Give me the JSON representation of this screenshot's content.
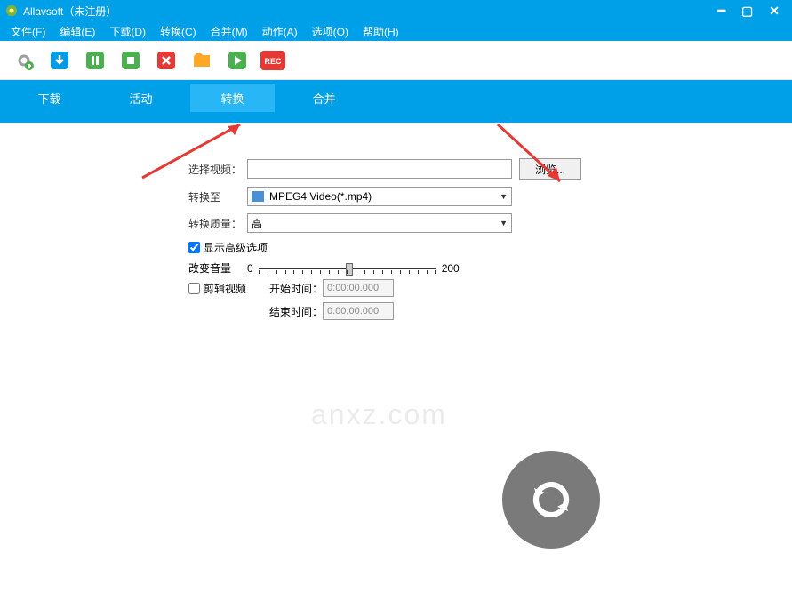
{
  "title": "Allavsoft（未注册）",
  "menu": {
    "file": "文件(F)",
    "edit": "编辑(E)",
    "download": "下载(D)",
    "convert": "转换(C)",
    "merge": "合并(M)",
    "action": "动作(A)",
    "options": "选项(O)",
    "help": "帮助(H)"
  },
  "tabs": {
    "download": "下载",
    "activity": "活动",
    "convert": "转换",
    "merge": "合并"
  },
  "form": {
    "select_video_label": "选择视频：",
    "browse_button": "浏览...",
    "convert_to_label": "转换至",
    "convert_to_value": "MPEG4 Video(*.mp4)",
    "quality_label": "转换质量：",
    "quality_value": "高",
    "show_advanced": "显示高级选项",
    "change_volume": "改变音量",
    "volume_min": "0",
    "volume_max": "200",
    "edit_video": "剪辑视频",
    "start_time_label": "开始时间：",
    "start_time_value": "0:00:00.000",
    "end_time_label": "结束时间：",
    "end_time_value": "0:00:00.000"
  },
  "watermark": "anxz.com"
}
